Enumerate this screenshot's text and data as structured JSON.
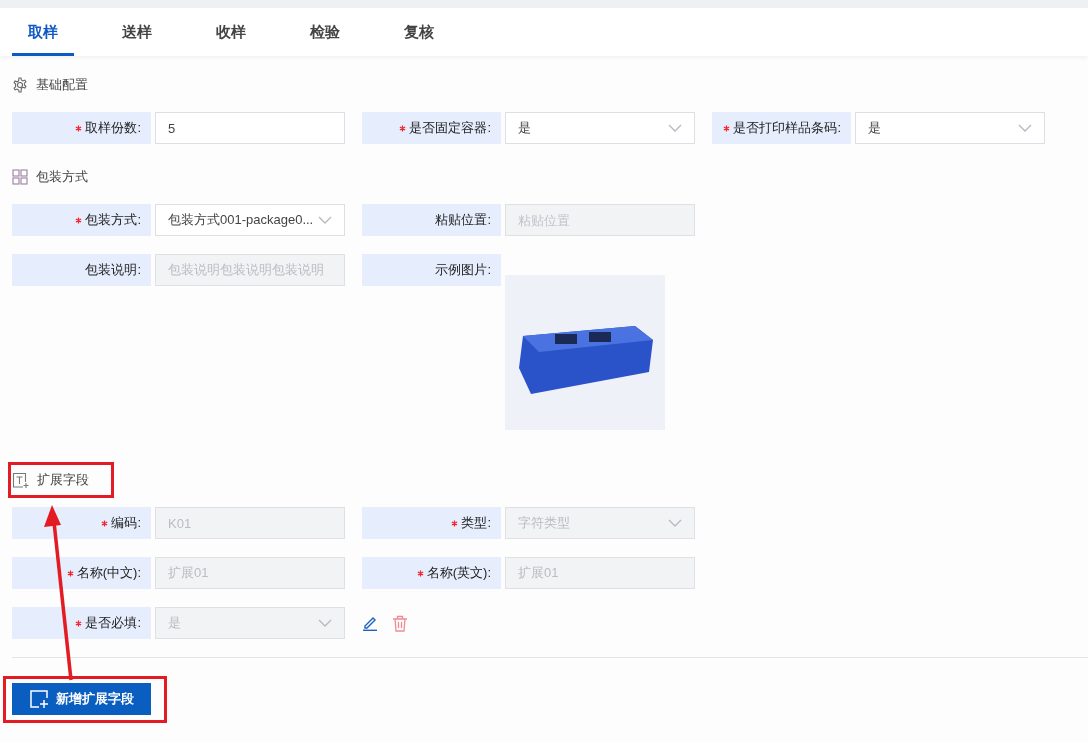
{
  "tabs": [
    {
      "label": "取样",
      "selected": true
    },
    {
      "label": "送样",
      "selected": false
    },
    {
      "label": "收样",
      "selected": false
    },
    {
      "label": "检验",
      "selected": false
    },
    {
      "label": "复核",
      "selected": false
    }
  ],
  "sections": [
    {
      "kind": "gear",
      "title": "基础配置",
      "rows": [
        {
          "fields": [
            {
              "kind": "text",
              "label": "取样份数:",
              "required": true,
              "value": "5",
              "disabled": false
            },
            {
              "kind": "select",
              "label": "是否固定容器:",
              "required": true,
              "value": "是",
              "disabled": false
            },
            {
              "kind": "select",
              "label": "是否打印样品条码:",
              "required": true,
              "value": "是",
              "disabled": false
            }
          ]
        }
      ]
    },
    {
      "kind": "grid",
      "title": "包装方式",
      "rows": [
        {
          "fields": [
            {
              "kind": "select",
              "label": "包装方式:",
              "required": true,
              "value": "包装方式001-package0...",
              "disabled": false
            },
            {
              "kind": "text",
              "label": "粘贴位置:",
              "required": false,
              "placeholder": "粘贴位置",
              "disabled": true
            }
          ]
        },
        {
          "fields": [
            {
              "kind": "text",
              "label": "包装说明:",
              "required": false,
              "value": "包装说明包装说明包装说明",
              "disabled": true
            },
            {
              "kind": "image",
              "label": "示例图片:",
              "required": false
            }
          ]
        }
      ]
    },
    {
      "kind": "text-plus",
      "title": "扩展字段",
      "rows": [
        {
          "fields": [
            {
              "kind": "text",
              "label": "编码:",
              "required": true,
              "value": "K01",
              "disabled": true
            },
            {
              "kind": "select",
              "label": "类型:",
              "required": true,
              "value": "字符类型",
              "disabled": true
            }
          ]
        },
        {
          "fields": [
            {
              "kind": "text",
              "label": "名称(中文):",
              "required": true,
              "value": "扩展01",
              "disabled": true
            },
            {
              "kind": "text",
              "label": "名称(英文):",
              "required": true,
              "value": "扩展01",
              "disabled": true
            }
          ]
        },
        {
          "fields": [
            {
              "kind": "select",
              "label": "是否必填:",
              "required": true,
              "value": "是",
              "disabled": true
            },
            {
              "kind": "actions"
            }
          ]
        }
      ]
    }
  ],
  "add_button": {
    "label": "新增扩展字段"
  }
}
